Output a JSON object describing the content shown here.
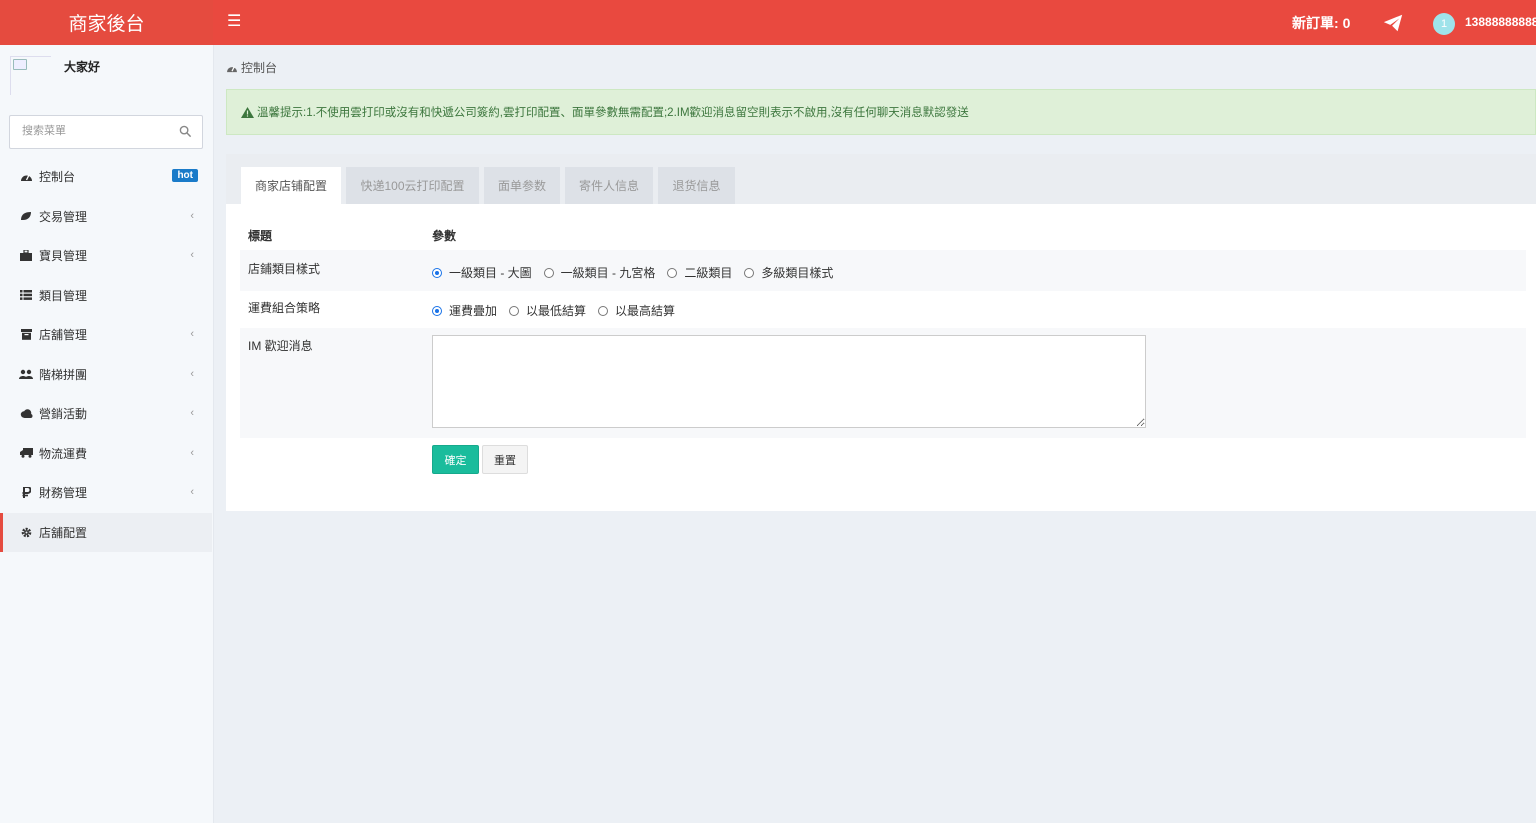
{
  "header": {
    "logo": "商家後台",
    "new_orders_label": "新訂單:",
    "new_orders_count": "0",
    "user_avatar_text": "1",
    "user_phone": "13888888888",
    "icons": {
      "menu": "hamburger-icon",
      "send": "paper-plane-icon"
    }
  },
  "sidebar": {
    "greeting": "大家好",
    "search_placeholder": "搜索菜單",
    "items": [
      {
        "label": "控制台",
        "icon": "dashboard-icon",
        "badge": "hot"
      },
      {
        "label": "交易管理",
        "icon": "leaf-icon",
        "has_submenu": true
      },
      {
        "label": "寶貝管理",
        "icon": "briefcase-icon",
        "has_submenu": true
      },
      {
        "label": "類目管理",
        "icon": "list-icon"
      },
      {
        "label": "店舖管理",
        "icon": "archive-icon",
        "has_submenu": true
      },
      {
        "label": "階梯拼團",
        "icon": "users-icon",
        "has_submenu": true
      },
      {
        "label": "營銷活動",
        "icon": "cloud-icon",
        "has_submenu": true
      },
      {
        "label": "物流運費",
        "icon": "truck-icon",
        "has_submenu": true
      },
      {
        "label": "財務管理",
        "icon": "ruble-icon",
        "has_submenu": true
      },
      {
        "label": "店舖配置",
        "icon": "gear-icon",
        "active": true
      }
    ]
  },
  "breadcrumb": {
    "label": "控制台"
  },
  "alert": {
    "text": "溫馨提示:1.不使用雲打印或沒有和快遞公司簽約,雲打印配置、面單參數無需配置;2.IM歡迎消息留空則表示不啟用,沒有任何聊天消息默認發送"
  },
  "tabs": [
    "商家店铺配置",
    "快递100云打印配置",
    "面单参数",
    "寄件人信息",
    "退货信息"
  ],
  "form": {
    "col_title": "標題",
    "col_param": "參數",
    "rows": [
      {
        "label": "店鋪類目樣式",
        "options": [
          "一級類目 - 大圖",
          "一級類目 - 九宮格",
          "二級類目",
          "多級類目樣式"
        ],
        "selected": 0
      },
      {
        "label": "運費組合策略",
        "options": [
          "運費疊加",
          "以最低結算",
          "以最高結算"
        ],
        "selected": 0
      },
      {
        "label": "IM 歡迎消息",
        "value": ""
      }
    ],
    "submit_label": "確定",
    "reset_label": "重置"
  },
  "colors": {
    "header": "#e9493f",
    "accent_button": "#1abc9c",
    "badge": "#1a7bc9"
  }
}
